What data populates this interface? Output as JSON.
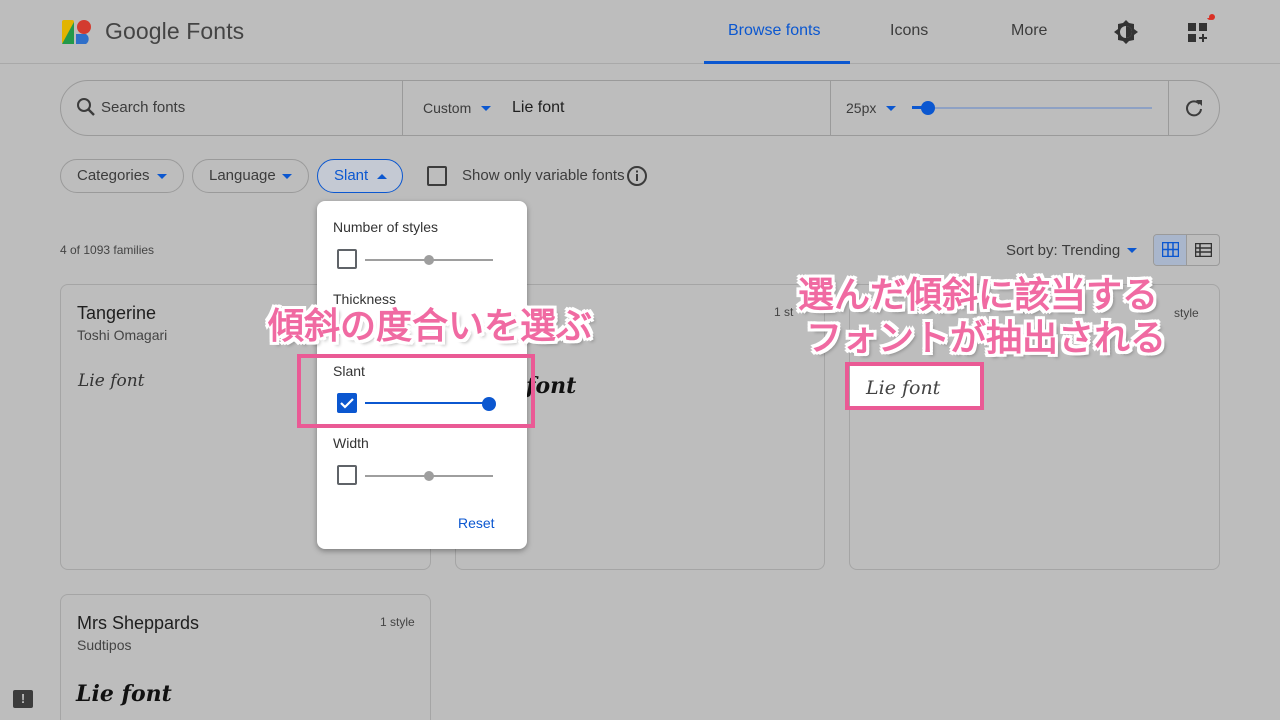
{
  "header": {
    "brand": "Google Fonts",
    "nav": [
      {
        "label": "Browse fonts",
        "active": true
      },
      {
        "label": "Icons",
        "active": false
      },
      {
        "label": "More",
        "active": false
      }
    ],
    "accent_color": "#0b57d0"
  },
  "search": {
    "placeholder": "Search fonts",
    "preview_mode": "Custom",
    "preview_text": "Lie font",
    "size_label": "25px",
    "size_slider_value_fraction": 0.07
  },
  "filters": {
    "chips": [
      "Categories",
      "Language",
      "Slant"
    ],
    "variable_only_label": "Show only variable fonts"
  },
  "results": {
    "count_text": "4 of 1093 families",
    "sort_label": "Sort by: Trending"
  },
  "dropdown": {
    "number_of_styles": "Number of styles",
    "thickness": "Thickness",
    "slant": "Slant",
    "width": "Width",
    "reset": "Reset",
    "slant_checked": true,
    "slant_value_fraction": 1.0
  },
  "cards": [
    {
      "name": "Tangerine",
      "author": "Toshi Omagari",
      "styles": "",
      "sample": "Lie font"
    },
    {
      "name": "",
      "author": "",
      "styles": "1 st",
      "sample": "font"
    },
    {
      "name": "",
      "author": "",
      "styles": "style",
      "sample": "Lie font"
    },
    {
      "name": "Mrs Sheppards",
      "author": "Sudtipos",
      "styles": "1 style",
      "sample": "Lie font"
    }
  ],
  "annotations": {
    "left": "傾斜の度合いを選ぶ",
    "right_line1": "選んだ傾斜に該当する",
    "right_line2": "フォントが抽出される",
    "color": "#ea5a95"
  },
  "feedback_icon": "!"
}
